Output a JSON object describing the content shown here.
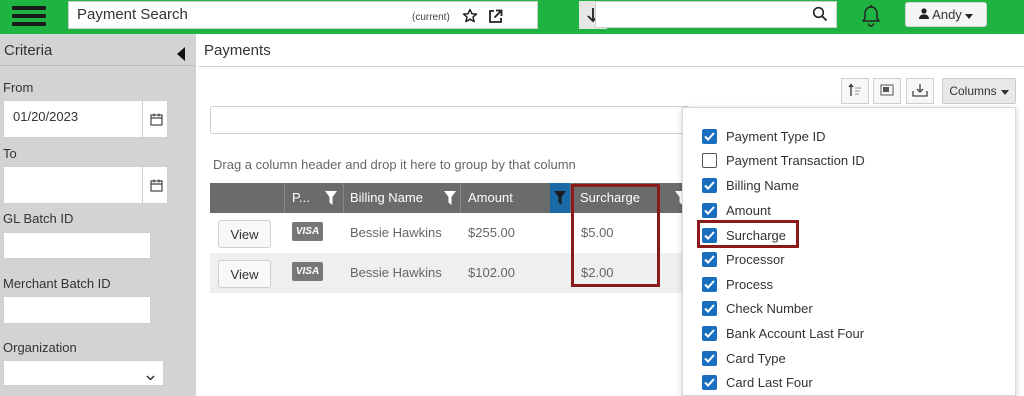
{
  "header": {
    "app_title": "Payment Search",
    "title_suffix": "(current)",
    "search_placeholder": "",
    "user_name": "Andy",
    "accent_color": "#1fb341"
  },
  "sidebar": {
    "title": "Criteria",
    "from_label": "From",
    "from_value": "01/20/2023",
    "to_label": "To",
    "to_value": "",
    "gl_batch_label": "GL Batch ID",
    "gl_batch_value": "",
    "merchant_batch_label": "Merchant Batch ID",
    "merchant_batch_value": "",
    "organization_label": "Organization",
    "organization_value": ""
  },
  "main": {
    "title": "Payments",
    "columns_button": "Columns",
    "group_hint": "Drag a column header and drop it here to group by that column",
    "grid": {
      "headers": {
        "type": "P...",
        "billing_name": "Billing Name",
        "amount": "Amount",
        "surcharge": "Surcharge"
      },
      "rows": [
        {
          "action": "View",
          "card_icon": "visa-icon",
          "card_label": "VISA",
          "billing_name": "Bessie Hawkins",
          "amount": "$255.00",
          "surcharge": "$5.00"
        },
        {
          "action": "View",
          "card_icon": "visa-icon",
          "card_label": "VISA",
          "billing_name": "Bessie Hawkins",
          "amount": "$102.00",
          "surcharge": "$2.00"
        }
      ]
    }
  },
  "columns_menu": {
    "items": [
      {
        "label": "Payment Type ID",
        "checked": true
      },
      {
        "label": "Payment Transaction ID",
        "checked": false
      },
      {
        "label": "Billing Name",
        "checked": true
      },
      {
        "label": "Amount",
        "checked": true
      },
      {
        "label": "Surcharge",
        "checked": true
      },
      {
        "label": "Processor",
        "checked": true
      },
      {
        "label": "Process",
        "checked": true
      },
      {
        "label": "Check Number",
        "checked": true
      },
      {
        "label": "Bank Account Last Four",
        "checked": true
      },
      {
        "label": "Card Type",
        "checked": true
      },
      {
        "label": "Card Last Four",
        "checked": true
      }
    ],
    "checkbox_color": "#1a6ec0",
    "highlight_color": "#8b1a1a"
  }
}
